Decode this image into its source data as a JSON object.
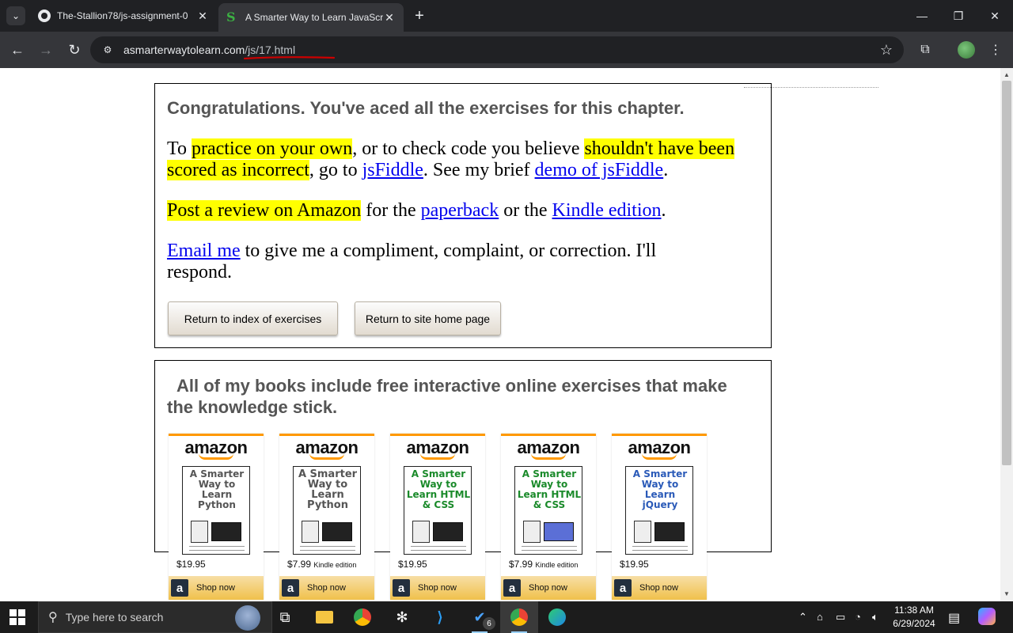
{
  "browser": {
    "tabs": [
      {
        "title": "The-Stallion78/js-assignment-0",
        "icon": "github-icon"
      },
      {
        "title": "A Smarter Way to Learn JavaScr",
        "icon": "smarter-way-favicon"
      }
    ],
    "new_tab": "+",
    "window_controls": {
      "minimize": "—",
      "restore": "❐",
      "close": "✕"
    },
    "nav": {
      "back": "←",
      "forward": "→",
      "reload": "↻"
    },
    "url": {
      "host": "asmarterwaytolearn.com",
      "path": "/js/17.html"
    },
    "annotation_color": "#cc0000"
  },
  "page": {
    "congrats_heading": "Congratulations. You've aced all the exercises for this chapter.",
    "p1": {
      "t1": "To ",
      "h1": "practice on your own",
      "t2": ", or to check code you believe ",
      "h2": "shouldn't have been scored as incorrect",
      "t3": ", go to ",
      "link1": "jsFiddle",
      "t4": ". See my brief ",
      "link2": "demo of jsFiddle",
      "t5": "."
    },
    "p2": {
      "h1": "Post a review on Amazon",
      "t1": " for the ",
      "link1": "paperback",
      "t2": " or the ",
      "link2": "Kindle edition",
      "t3": "."
    },
    "p3": {
      "link1": "Email me",
      "t1": " to give me a compliment, complaint, or correction. I'll respond."
    },
    "buttons": {
      "index": "Return to index of exercises",
      "home": "Return to site home page"
    },
    "books_heading": "All of my books include free interactive online exercises that make the knowledge stick.",
    "ads": [
      {
        "logo": "amazon",
        "title": "A Smarter Way to Learn Python",
        "title_color": "#555555",
        "price": "$19.95",
        "edition": "",
        "shop": "Shop now"
      },
      {
        "logo": "amazon",
        "title": "A Smarter Way to Learn Python",
        "title_color": "#555555",
        "price": "$7.99",
        "edition": "Kindle edition",
        "shop": "Shop now"
      },
      {
        "logo": "amazon",
        "title": "A Smarter Way to Learn HTML & CSS",
        "title_color": "#1a8a2a",
        "price": "$19.95",
        "edition": "",
        "shop": "Shop now"
      },
      {
        "logo": "amazon",
        "title": "A Smarter Way to Learn HTML & CSS",
        "title_color": "#1a8a2a",
        "price": "$7.99",
        "edition": "Kindle edition",
        "shop": "Shop now"
      },
      {
        "logo": "amazon",
        "title": "A Smarter Way to Learn jQuery",
        "title_color": "#2a5ab8",
        "price": "$19.95",
        "edition": "",
        "shop": "Shop now"
      }
    ]
  },
  "taskbar": {
    "search_placeholder": "Type here to search",
    "apps": [
      "task-view-icon",
      "file-explorer-icon",
      "chrome-icon",
      "chatgpt-icon",
      "vscode-icon",
      "todo-icon",
      "chrome-active-icon",
      "edge-icon"
    ],
    "todo_badge": "6",
    "time": "11:38 AM",
    "date": "6/29/2024"
  }
}
